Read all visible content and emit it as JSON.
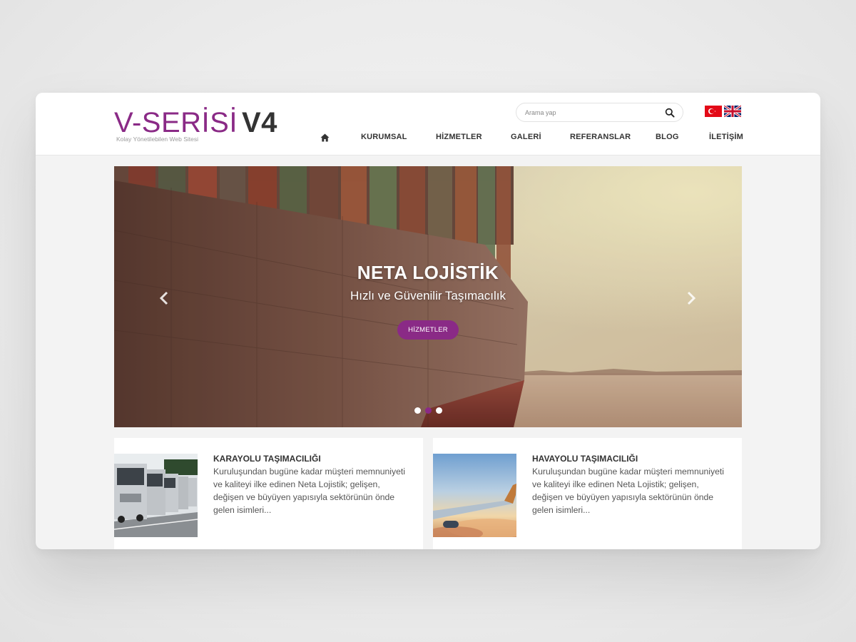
{
  "brand": {
    "logo_thin": "V-SERİSİ",
    "logo_bold": "V4",
    "tagline": "Kolay Yönetilebilen Web Sitesi",
    "accent_color": "#8a2a86"
  },
  "search": {
    "placeholder": "Arama yap",
    "icon": "search-icon"
  },
  "languages": [
    {
      "code": "tr",
      "icon": "turkey-flag-icon"
    },
    {
      "code": "en",
      "icon": "uk-flag-icon"
    }
  ],
  "nav": {
    "home_icon": "home-icon",
    "items": [
      "KURUMSAL",
      "HİZMETLER",
      "GALERİ",
      "REFERANSLAR",
      "BLOG",
      "İLETİŞİM"
    ]
  },
  "slider": {
    "title": "NETA LOJİSTİK",
    "subtitle": "Hızlı ve Güvenilir Taşımacılık",
    "button_label": "HİZMETLER",
    "slide_count": 3,
    "active_slide": 2
  },
  "cards": [
    {
      "title": "KARAYOLU TAŞIMACILIĞI",
      "text": "Kuruluşundan bugüne kadar müşteri memnuniyeti ve kaliteyi ilke edinen Neta Lojistik; gelişen, değişen ve büyüyen yapısıyla sektörünün önde gelen isimleri...",
      "image": "trucks-photo"
    },
    {
      "title": "HAVAYOLU TAŞIMACILIĞI",
      "text": "Kuruluşundan bugüne kadar müşteri memnuniyeti ve kaliteyi ilke edinen Neta Lojistik; gelişen, değişen ve büyüyen yapısıyla sektörünün önde gelen isimleri...",
      "image": "airplane-wing-photo"
    }
  ]
}
